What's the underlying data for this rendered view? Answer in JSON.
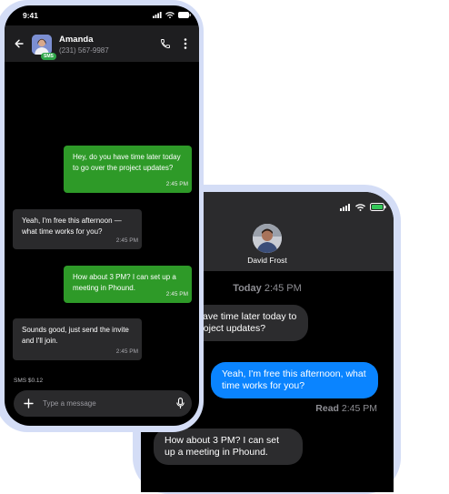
{
  "back_phone": {
    "contact_name": "David Frost",
    "day_label": "Today",
    "day_time": "2:45 PM",
    "messages": [
      {
        "direction": "in",
        "text": "Hey, do you have time later today to go over the project updates?"
      },
      {
        "direction": "out",
        "text": "Yeah, I'm free this afternoon, what time works for you?"
      },
      {
        "direction": "in",
        "text": "How about 3 PM? I can set up a meeting in Phound."
      }
    ],
    "read_label": "Read",
    "read_time": "2:45 PM"
  },
  "front_phone": {
    "status_time": "9:41",
    "contact_name": "Amanda",
    "contact_number": "(231) 567-9987",
    "channel_badge": "SMS",
    "messages": [
      {
        "direction": "out",
        "text": "Hey, do you have time later today to go over the project updates?",
        "time": "2:45 PM"
      },
      {
        "direction": "in",
        "text": "Yeah, I'm free this afternoon — what time works for you?",
        "time": "2:45 PM"
      },
      {
        "direction": "out",
        "text": "How about 3 PM? I can set up a meeting in Phound.",
        "time": "2:45 PM"
      },
      {
        "direction": "in",
        "text": "Sounds good, just send the invite and I'll join.",
        "time": "2:45 PM"
      }
    ],
    "sms_cost": "SMS $0.12",
    "compose": {
      "placeholder": "Type a message"
    }
  },
  "colors": {
    "frame": "#d4ddf6",
    "sent_green": "#2e9a28",
    "imessage_blue": "#0a84ff",
    "received_gray": "#2a2a2c"
  },
  "icons": [
    "back-arrow-icon",
    "phone-call-icon",
    "more-vert-icon",
    "add-icon",
    "microphone-icon",
    "signal-icon",
    "wifi-icon",
    "battery-icon"
  ]
}
